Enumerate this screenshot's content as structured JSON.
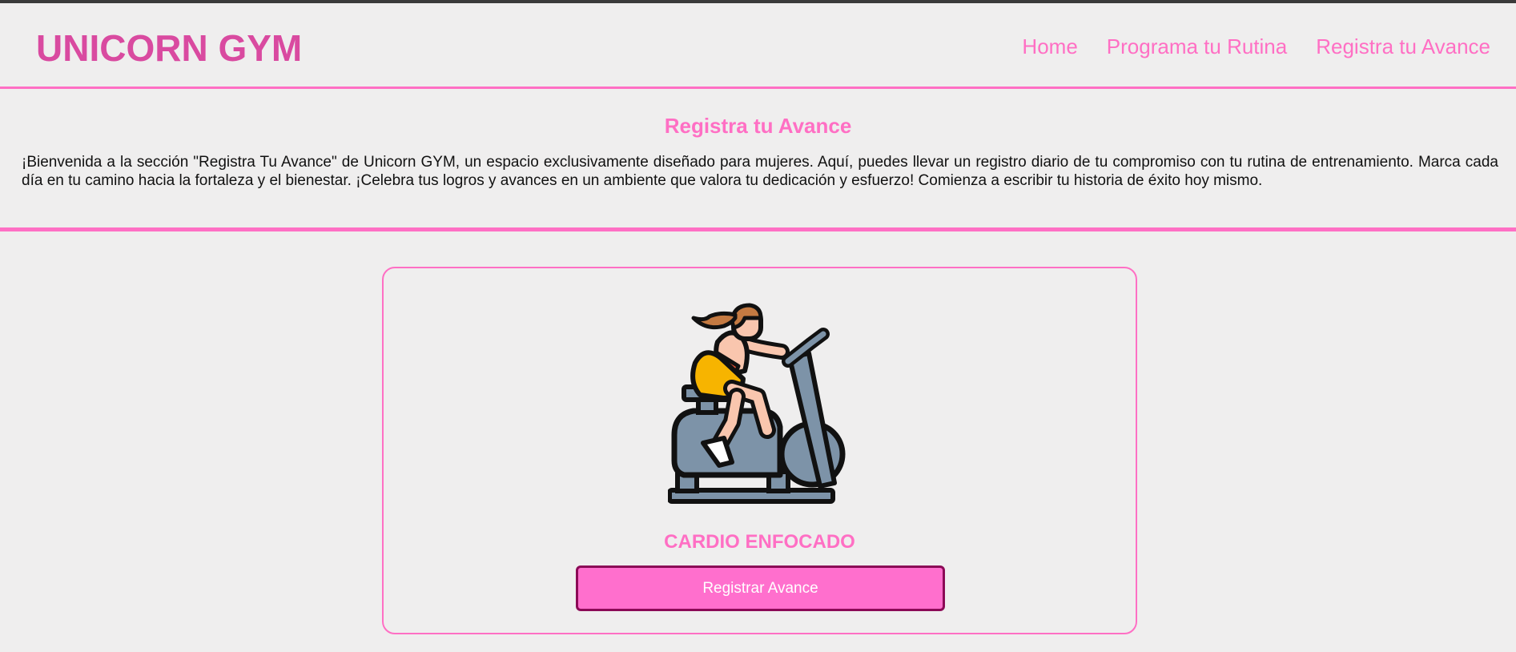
{
  "header": {
    "logo": "UNICORN GYM",
    "nav": [
      {
        "label": "Home"
      },
      {
        "label": "Programa tu Rutina"
      },
      {
        "label": "Registra tu Avance"
      }
    ]
  },
  "intro": {
    "title": "Registra tu Avance",
    "text": "¡Bienvenida a la sección \"Registra Tu Avance\" de Unicorn GYM, un espacio exclusivamente diseñado para mujeres. Aquí, puedes llevar un registro diario de tu compromiso con tu rutina de entrenamiento. Marca cada día en tu camino hacia la fortaleza y el bienestar. ¡Celebra tus logros y avances en un ambiente que valora tu dedicación y esfuerzo! Comienza a escribir tu historia de éxito hoy mismo."
  },
  "card": {
    "icon": "stationary-bike-woman-icon",
    "title": "CARDIO ENFOCADO",
    "button_label": "Registrar Avance"
  },
  "colors": {
    "accent": "#ff6fc4",
    "logo": "#d94aa0",
    "button": "#ff6fcd",
    "button_border": "#8b0a56",
    "background": "#efeeee"
  }
}
